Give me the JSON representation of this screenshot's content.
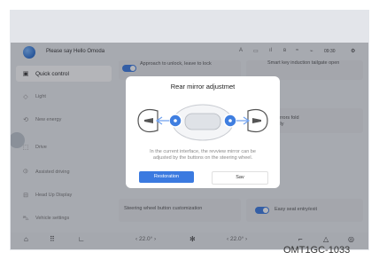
{
  "header": {
    "greeting": "Please say Hello Omoda",
    "time": "09:30",
    "status_icons": [
      "A-icon",
      "display-icon",
      "signal-icon",
      "bluetooth-icon",
      "wifi-icon",
      "settings-icon"
    ]
  },
  "sidebar": {
    "items": [
      {
        "label": "Quick control",
        "icon": "control-icon"
      },
      {
        "label": "Light",
        "icon": "light-icon"
      },
      {
        "label": "New energy",
        "icon": "energy-icon"
      },
      {
        "label": "Drive",
        "icon": "drive-icon"
      },
      {
        "label": "Assisted driving",
        "icon": "assist-icon"
      },
      {
        "label": "Head Up Display",
        "icon": "hud-icon"
      },
      {
        "label": "Vehicle settings",
        "icon": "vehicle-icon"
      }
    ]
  },
  "cards": {
    "approach_unlock": "Approach to unlock, leave to lock",
    "smart_key_tailgate": "Smart key induction tailgate open",
    "mirrors_fold_part1": "terior mirrors fold",
    "mirrors_fold_part2": "omatically",
    "steering_wheel_custom": "Steering wheel button customization",
    "easy_seat": "Easy seat entry/exit"
  },
  "bottombar": {
    "temp_left": "22.0°",
    "temp_right": "22.0°",
    "icons": [
      "home-icon",
      "apps-icon",
      "seat-icon",
      "fan-icon",
      "wiper-icon",
      "hazard-icon",
      "defrost-icon"
    ]
  },
  "modal": {
    "title": "Rear mirror adjustmet",
    "text": "In the current interface, the revview mirror can be adjusted by the buttons on the steering wheel.",
    "restoration_label": "Restoration",
    "save_label": "Sav"
  },
  "caption": "OMT1GC-1033"
}
